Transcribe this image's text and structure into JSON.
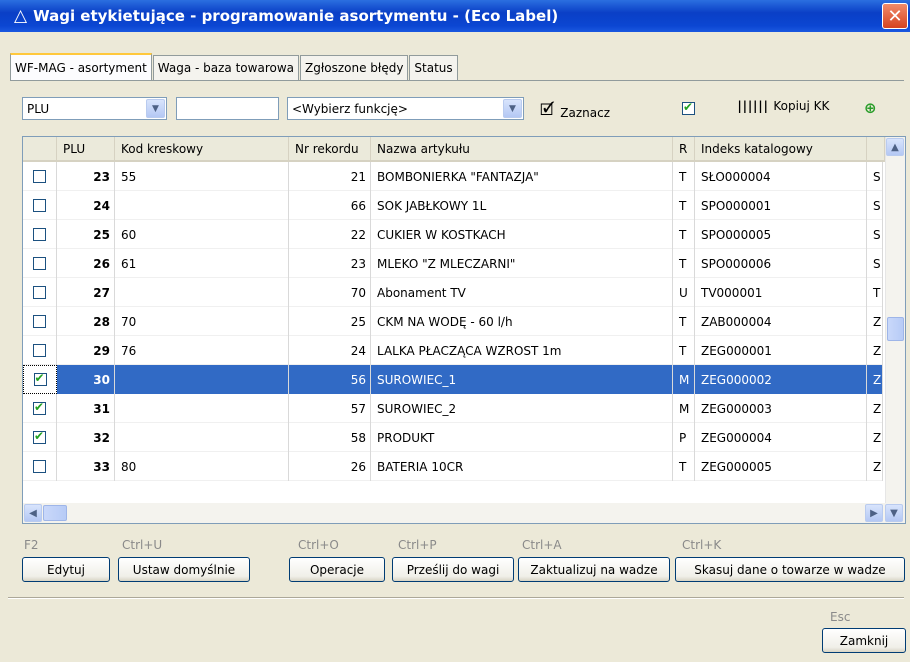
{
  "window": {
    "title": "Wagi etykietujące - programowanie asortymentu - (Eco Label)",
    "close_symbol": "✕"
  },
  "tabs": [
    {
      "label": "WF-MAG - asortyment",
      "active": true
    },
    {
      "label": "Waga - baza towarowa",
      "active": false
    },
    {
      "label": "Zgłoszone błędy",
      "active": false
    },
    {
      "label": "Status",
      "active": false
    }
  ],
  "toolbar": {
    "field_select": "PLU",
    "search_value": "",
    "function_select": "<Wybierz funkcję>",
    "mark_label": "Zaznacz",
    "copy_label": "Kopiuj KK"
  },
  "grid": {
    "columns": [
      "PLU",
      "Kod kreskowy",
      "Nr rekordu",
      "Nazwa artykułu",
      "R",
      "Indeks katalogowy"
    ],
    "rows": [
      {
        "checked": false,
        "plu": "23",
        "barcode": "55",
        "rec": "21",
        "name": "BOMBONIERKA \"FANTAZJA\"",
        "r": "T",
        "index": "SŁO000004",
        "extra": "S"
      },
      {
        "checked": false,
        "plu": "24",
        "barcode": "",
        "rec": "66",
        "name": "SOK JABŁKOWY 1L",
        "r": "T",
        "index": "SPO000001",
        "extra": "S"
      },
      {
        "checked": false,
        "plu": "25",
        "barcode": "60",
        "rec": "22",
        "name": "CUKIER W KOSTKACH",
        "r": "T",
        "index": "SPO000005",
        "extra": "S"
      },
      {
        "checked": false,
        "plu": "26",
        "barcode": "61",
        "rec": "23",
        "name": "MLEKO \"Z MLECZARNI\"",
        "r": "T",
        "index": "SPO000006",
        "extra": "S"
      },
      {
        "checked": false,
        "plu": "27",
        "barcode": "",
        "rec": "70",
        "name": "Abonament TV",
        "r": "U",
        "index": "TV000001",
        "extra": "T"
      },
      {
        "checked": false,
        "plu": "28",
        "barcode": "70",
        "rec": "25",
        "name": "CKM NA WODĘ - 60 l/h",
        "r": "T",
        "index": "ZAB000004",
        "extra": "Z"
      },
      {
        "checked": false,
        "plu": "29",
        "barcode": "76",
        "rec": "24",
        "name": "LALKA PŁACZĄCA WZROST 1m",
        "r": "T",
        "index": "ZEG000001",
        "extra": "Z"
      },
      {
        "checked": true,
        "plu": "30",
        "barcode": "",
        "rec": "56",
        "name": "SUROWIEC_1",
        "r": "M",
        "index": "ZEG000002",
        "extra": "Z",
        "selected": true
      },
      {
        "checked": true,
        "plu": "31",
        "barcode": "",
        "rec": "57",
        "name": "SUROWIEC_2",
        "r": "M",
        "index": "ZEG000003",
        "extra": "Z"
      },
      {
        "checked": true,
        "plu": "32",
        "barcode": "",
        "rec": "58",
        "name": "PRODUKT",
        "r": "P",
        "index": "ZEG000004",
        "extra": "Z"
      },
      {
        "checked": false,
        "plu": "33",
        "barcode": "80",
        "rec": "26",
        "name": "BATERIA 10CR",
        "r": "T",
        "index": "ZEG000005",
        "extra": "Z"
      }
    ]
  },
  "shortcuts": {
    "edit": "F2",
    "defaults": "Ctrl+U",
    "ops": "Ctrl+O",
    "send": "Ctrl+P",
    "update": "Ctrl+A",
    "delete": "Ctrl+K",
    "close": "Esc"
  },
  "buttons": {
    "edit": "Edytuj",
    "defaults": "Ustaw domyślnie",
    "ops": "Operacje",
    "send": "Prześlij do wagi",
    "update": "Zaktualizuj na wadze",
    "delete": "Skasuj dane o towarze w wadze",
    "close": "Zamknij"
  },
  "colors": {
    "selection": "#316ac5",
    "title_bar": "#0a3fc6",
    "close_button": "#d5421f"
  }
}
